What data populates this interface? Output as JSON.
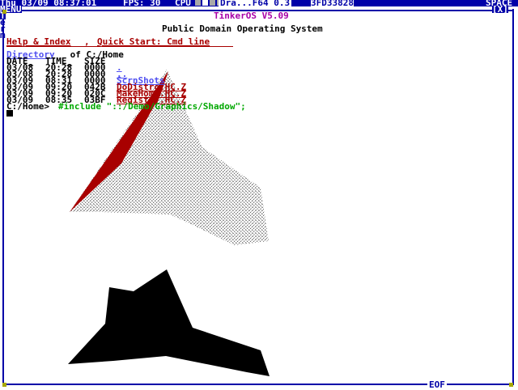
{
  "topbar": {
    "clock": "Thu 03/09 08:37:01",
    "fps": "FPS: 30",
    "cpu_label": "CPU",
    "task_title": "Dra...F64 0.3",
    "hex_addr": "3FD33828",
    "space_label": "SPACE"
  },
  "window": {
    "menu_label": "MENU",
    "title": "TinkerOS V5.09",
    "close_buttons": "[X]",
    "side_letters": [
      "T",
      "e",
      "r",
      "m"
    ],
    "eof_label": "EOF"
  },
  "content": {
    "heading": "Public Domain Operating System",
    "help_link": "Help & Index",
    "separator": ", ",
    "quickstart_link": "Quick Start: Cmd line",
    "dir_link": "Directory",
    "dir_rest": " of C:/Home",
    "header_date": "DATE_",
    "header_time": "TIME_",
    "header_size": "SIZE",
    "rows": [
      {
        "date": "03/08",
        "time": "20:28",
        "size": "0000",
        "name": "."
      },
      {
        "date": "03/08",
        "time": "20:28",
        "size": "0000",
        "name": ".."
      },
      {
        "date": "03/09",
        "time": "08:31",
        "size": "0000",
        "name": "ScrnShots"
      },
      {
        "date": "03/09",
        "time": "09:20",
        "size": "042B",
        "name": "DoDistro.HC.Z"
      },
      {
        "date": "03/09",
        "time": "09:20",
        "size": "020C",
        "name": "MakeHome.HC.Z"
      },
      {
        "date": "03/09",
        "time": "08:35",
        "size": "03BF",
        "name": "Registry.HC.Z"
      }
    ],
    "prompt": "C:/Home>",
    "command": "#include \"::/Demo/Graphics/Shadow\";"
  },
  "colors": {
    "accent_blue": "#0000a8",
    "link_red": "#a80000",
    "title_purple": "#a800a8",
    "cmd_green": "#00a800",
    "shape_light": "#c8c8c8",
    "shape_dark_face": "#a80000",
    "shadow": "#000000"
  }
}
